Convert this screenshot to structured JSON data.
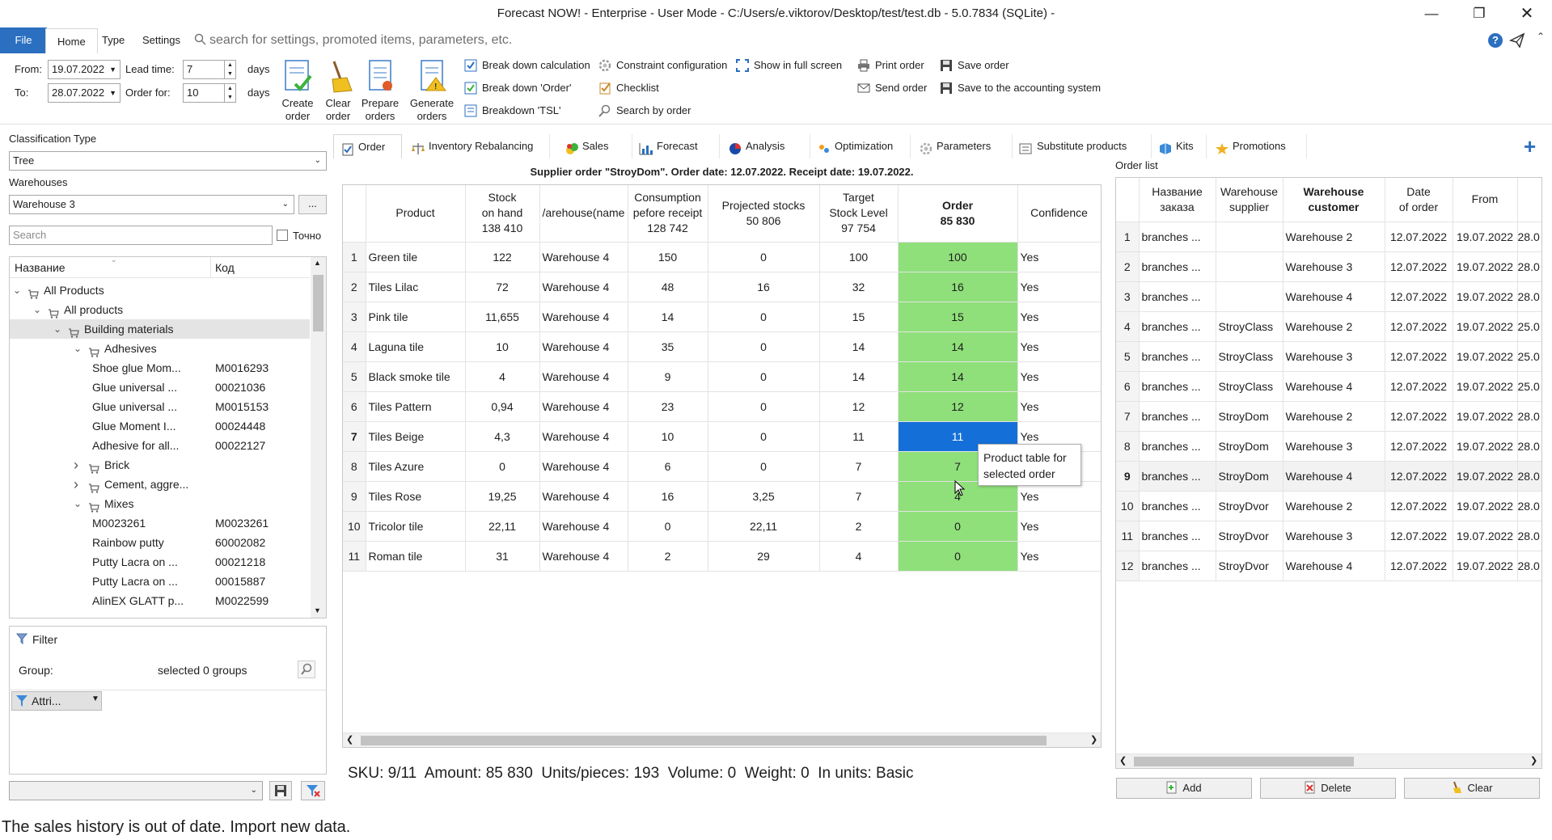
{
  "window": {
    "title": "Forecast NOW! - Enterprise - User Mode - C:/Users/e.viktorov/Desktop/test/test.db - 5.0.7834 (SQLite) -"
  },
  "menu": {
    "file": "File",
    "home": "Home",
    "type": "Type",
    "settings": "Settings",
    "search_placeholder": "search for settings, promoted items, parameters, etc."
  },
  "ribbon": {
    "from_label": "From:",
    "from_value": "19.07.2022",
    "to_label": "To:",
    "to_value": "28.07.2022",
    "lead_label": "Lead time:",
    "lead_value": "7",
    "lead_unit": "days",
    "orderfor_label": "Order for:",
    "orderfor_value": "10",
    "orderfor_unit": "days",
    "create_l1": "Create",
    "create_l2": "order",
    "clear_l1": "Clear",
    "clear_l2": "order",
    "prepare_l1": "Prepare",
    "prepare_l2": "orders",
    "generate_l1": "Generate",
    "generate_l2": "orders",
    "breakdown_calc": "Break down calculation",
    "breakdown_order": "Break down 'Order'",
    "breakdown_tsl": "Breakdown 'TSL'",
    "constraint_config": "Constraint configuration",
    "checklist": "Checklist",
    "search_by_order": "Search by order",
    "full_screen": "Show in full screen",
    "print_order": "Print order",
    "send_order": "Send order",
    "save_order": "Save order",
    "save_accounting": "Save to the accounting system"
  },
  "left": {
    "class_type_label": "Classification Type",
    "class_type_value": "Tree",
    "warehouses_label": "Warehouses",
    "warehouse_value": "Warehouse 3",
    "more_btn": "...",
    "search_placeholder": "Search",
    "exact_label": "Точно",
    "col_name": "Название",
    "col_code": "Код",
    "tree": [
      {
        "name": "All Products",
        "code": "",
        "level": 0,
        "exp": "open"
      },
      {
        "name": "All products",
        "code": "",
        "level": 1,
        "exp": "open"
      },
      {
        "name": "Building materials",
        "code": "",
        "level": 2,
        "exp": "open"
      },
      {
        "name": "Adhesives",
        "code": "",
        "level": 3,
        "exp": "open"
      },
      {
        "name": "Shoe glue Mom...",
        "code": "M0016293",
        "level": 4,
        "exp": ""
      },
      {
        "name": "Glue universal ...",
        "code": "00021036",
        "level": 4,
        "exp": ""
      },
      {
        "name": "Glue universal ...",
        "code": "M0015153",
        "level": 4,
        "exp": ""
      },
      {
        "name": "Glue Moment I...",
        "code": "00024448",
        "level": 4,
        "exp": ""
      },
      {
        "name": "Adhesive for all...",
        "code": "00022127",
        "level": 4,
        "exp": ""
      },
      {
        "name": "Brick",
        "code": "",
        "level": 3,
        "exp": "closed"
      },
      {
        "name": "Cement, aggre...",
        "code": "",
        "level": 3,
        "exp": "closed"
      },
      {
        "name": "Mixes",
        "code": "",
        "level": 3,
        "exp": "open"
      },
      {
        "name": "M0023261",
        "code": "M0023261",
        "level": 4,
        "exp": ""
      },
      {
        "name": "Rainbow putty",
        "code": "60002082",
        "level": 4,
        "exp": ""
      },
      {
        "name": "Putty Lacra on ...",
        "code": "00021218",
        "level": 4,
        "exp": ""
      },
      {
        "name": "Putty Lacra on ...",
        "code": "00015887",
        "level": 4,
        "exp": ""
      },
      {
        "name": "AlinEX GLATT p...",
        "code": "M0022599",
        "level": 4,
        "exp": ""
      }
    ],
    "filter_title": "Filter",
    "group_label": "Group:",
    "group_value": "selected 0 groups",
    "attri_label": "Attri..."
  },
  "tabs": [
    "Order",
    "Inventory Rebalancing",
    "Sales",
    "Forecast",
    "Analysis",
    "Optimization",
    "Parameters",
    "Substitute products",
    "Kits",
    "Promotions"
  ],
  "order": {
    "header": "Supplier order \"StroyDom\". Order date: 12.07.2022. Receipt date: 19.07.2022.",
    "cols": {
      "product": "Product",
      "stock1": "Stock",
      "stock2": "on hand",
      "stock3": "138 410",
      "wh": "/arehouse(name",
      "cons1": "Consumption",
      "cons2": "pefore receipt",
      "cons3": "128 742",
      "proj1": "Projected stocks",
      "proj2": "50 806",
      "tsl1": "Target",
      "tsl2": "Stock Level",
      "tsl3": "97 754",
      "ord1": "Order",
      "ord2": "85 830",
      "conf": "Confidence"
    },
    "rows": [
      {
        "n": "1",
        "product": "Green tile",
        "stock": "122",
        "wh": "Warehouse 4",
        "cons": "150",
        "proj": "0",
        "tsl": "100",
        "order": "100",
        "conf": "Yes"
      },
      {
        "n": "2",
        "product": "Tiles Lilac",
        "stock": "72",
        "wh": "Warehouse 4",
        "cons": "48",
        "proj": "16",
        "tsl": "32",
        "order": "16",
        "conf": "Yes"
      },
      {
        "n": "3",
        "product": "Pink tile",
        "stock": "11,655",
        "wh": "Warehouse 4",
        "cons": "14",
        "proj": "0",
        "tsl": "15",
        "order": "15",
        "conf": "Yes"
      },
      {
        "n": "4",
        "product": "Laguna tile",
        "stock": "10",
        "wh": "Warehouse 4",
        "cons": "35",
        "proj": "0",
        "tsl": "14",
        "order": "14",
        "conf": "Yes"
      },
      {
        "n": "5",
        "product": "Black smoke tile",
        "stock": "4",
        "wh": "Warehouse 4",
        "cons": "9",
        "proj": "0",
        "tsl": "14",
        "order": "14",
        "conf": "Yes"
      },
      {
        "n": "6",
        "product": "Tiles Pattern",
        "stock": "0,94",
        "wh": "Warehouse 4",
        "cons": "23",
        "proj": "0",
        "tsl": "12",
        "order": "12",
        "conf": "Yes"
      },
      {
        "n": "7",
        "product": "Tiles Beige",
        "stock": "4,3",
        "wh": "Warehouse 4",
        "cons": "10",
        "proj": "0",
        "tsl": "11",
        "order": "11",
        "conf": "Yes"
      },
      {
        "n": "8",
        "product": "Tiles Azure",
        "stock": "0",
        "wh": "Warehouse 4",
        "cons": "6",
        "proj": "0",
        "tsl": "7",
        "order": "7",
        "conf": ""
      },
      {
        "n": "9",
        "product": "Tiles Rose",
        "stock": "19,25",
        "wh": "Warehouse 4",
        "cons": "16",
        "proj": "3,25",
        "tsl": "7",
        "order": "4",
        "conf": "Yes"
      },
      {
        "n": "10",
        "product": "Tricolor tile",
        "stock": "22,11",
        "wh": "Warehouse 4",
        "cons": "0",
        "proj": "22,11",
        "tsl": "2",
        "order": "0",
        "conf": "Yes"
      },
      {
        "n": "11",
        "product": "Roman tile",
        "stock": "31",
        "wh": "Warehouse 4",
        "cons": "2",
        "proj": "29",
        "tsl": "4",
        "order": "0",
        "conf": "Yes"
      }
    ],
    "tooltip_l1": "Product table for",
    "tooltip_l2": "selected order",
    "summary": "SKU: 9/11  Amount: 85 830  Units/pieces: 193  Volume: 0  Weight: 0  In units: Basic"
  },
  "orderlist": {
    "title": "Order list",
    "cols": {
      "name1": "Название",
      "name2": "заказа",
      "sup1": "Warehouse",
      "sup2": "supplier",
      "cust1": "Warehouse",
      "cust2": "customer",
      "date1": "Date",
      "date2": "of order",
      "from": "From"
    },
    "rows": [
      {
        "n": "1",
        "name": "branches ...",
        "sup": "",
        "cust": "Warehouse 2",
        "date": "12.07.2022",
        "from": "19.07.2022",
        "to": "28.0"
      },
      {
        "n": "2",
        "name": "branches ...",
        "sup": "",
        "cust": "Warehouse 3",
        "date": "12.07.2022",
        "from": "19.07.2022",
        "to": "28.0"
      },
      {
        "n": "3",
        "name": "branches ...",
        "sup": "",
        "cust": "Warehouse 4",
        "date": "12.07.2022",
        "from": "19.07.2022",
        "to": "28.0"
      },
      {
        "n": "4",
        "name": "branches ...",
        "sup": "StroyClass",
        "cust": "Warehouse 2",
        "date": "12.07.2022",
        "from": "19.07.2022",
        "to": "25.0"
      },
      {
        "n": "5",
        "name": "branches ...",
        "sup": "StroyClass",
        "cust": "Warehouse 3",
        "date": "12.07.2022",
        "from": "19.07.2022",
        "to": "25.0"
      },
      {
        "n": "6",
        "name": "branches ...",
        "sup": "StroyClass",
        "cust": "Warehouse 4",
        "date": "12.07.2022",
        "from": "19.07.2022",
        "to": "25.0"
      },
      {
        "n": "7",
        "name": "branches ...",
        "sup": "StroyDom",
        "cust": "Warehouse 2",
        "date": "12.07.2022",
        "from": "19.07.2022",
        "to": "28.0"
      },
      {
        "n": "8",
        "name": "branches ...",
        "sup": "StroyDom",
        "cust": "Warehouse 3",
        "date": "12.07.2022",
        "from": "19.07.2022",
        "to": "28.0"
      },
      {
        "n": "9",
        "name": "branches ...",
        "sup": "StroyDom",
        "cust": "Warehouse 4",
        "date": "12.07.2022",
        "from": "19.07.2022",
        "to": "28.0"
      },
      {
        "n": "10",
        "name": "branches ...",
        "sup": "StroyDvor",
        "cust": "Warehouse 2",
        "date": "12.07.2022",
        "from": "19.07.2022",
        "to": "28.0"
      },
      {
        "n": "11",
        "name": "branches ...",
        "sup": "StroyDvor",
        "cust": "Warehouse 3",
        "date": "12.07.2022",
        "from": "19.07.2022",
        "to": "28.0"
      },
      {
        "n": "12",
        "name": "branches ...",
        "sup": "StroyDvor",
        "cust": "Warehouse 4",
        "date": "12.07.2022",
        "from": "19.07.2022",
        "to": "28.0"
      }
    ],
    "add": "Add",
    "delete": "Delete",
    "clear": "Clear"
  },
  "status": {
    "message": "The sales history is out of date. Import new data."
  },
  "colors": {
    "accent": "#2b6fc0",
    "order_cell": "#8fe07a",
    "selected_cell": "#1470d8"
  },
  "icons": [
    "help-icon",
    "send-icon",
    "collapse-ribbon-icon",
    "search-icon",
    "add-tab-icon",
    "filter-icon",
    "save-icon"
  ]
}
